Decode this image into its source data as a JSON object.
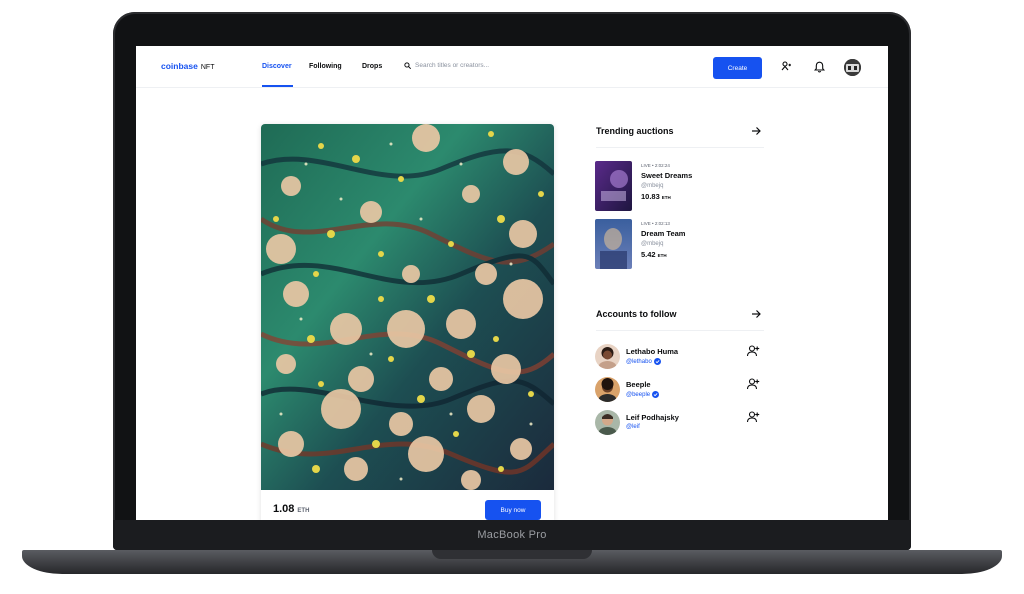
{
  "device": {
    "model_label": "MacBook Pro"
  },
  "topnav": {
    "logo_text": "coinbase",
    "logo_suffix": "NFT",
    "tabs": [
      {
        "label": "Discover",
        "active": true
      },
      {
        "label": "Following",
        "active": false
      },
      {
        "label": "Drops",
        "active": false
      }
    ],
    "search_placeholder": "Search titles or creators...",
    "create_label": "Create",
    "icons": [
      "leaderboard-icon",
      "bell-icon",
      "profile-avatar"
    ]
  },
  "featured": {
    "price": "1.08",
    "price_unit": "ETH",
    "buy_label": "Buy now"
  },
  "trending": {
    "title": "Trending auctions",
    "items": [
      {
        "live_text": "LIVE • 2:02:24",
        "name": "Sweet Dreams",
        "handle": "@mbejq",
        "price": "10.83",
        "unit": "ETH"
      },
      {
        "live_text": "LIVE • 2:02:13",
        "name": "Dream Team",
        "handle": "@mbejq",
        "price": "5.42",
        "unit": "ETH"
      }
    ]
  },
  "accounts": {
    "title": "Accounts to follow",
    "items": [
      {
        "name": "Lethabo Huma",
        "handle": "@lethabo",
        "verified": true
      },
      {
        "name": "Beeple",
        "handle": "@beeple",
        "verified": true
      },
      {
        "name": "Leif Podhajsky",
        "handle": "@leif",
        "verified": false
      }
    ]
  },
  "colors": {
    "brand_blue": "#1652f0",
    "text_primary": "#0a0b0d",
    "text_secondary": "#8a919e"
  }
}
